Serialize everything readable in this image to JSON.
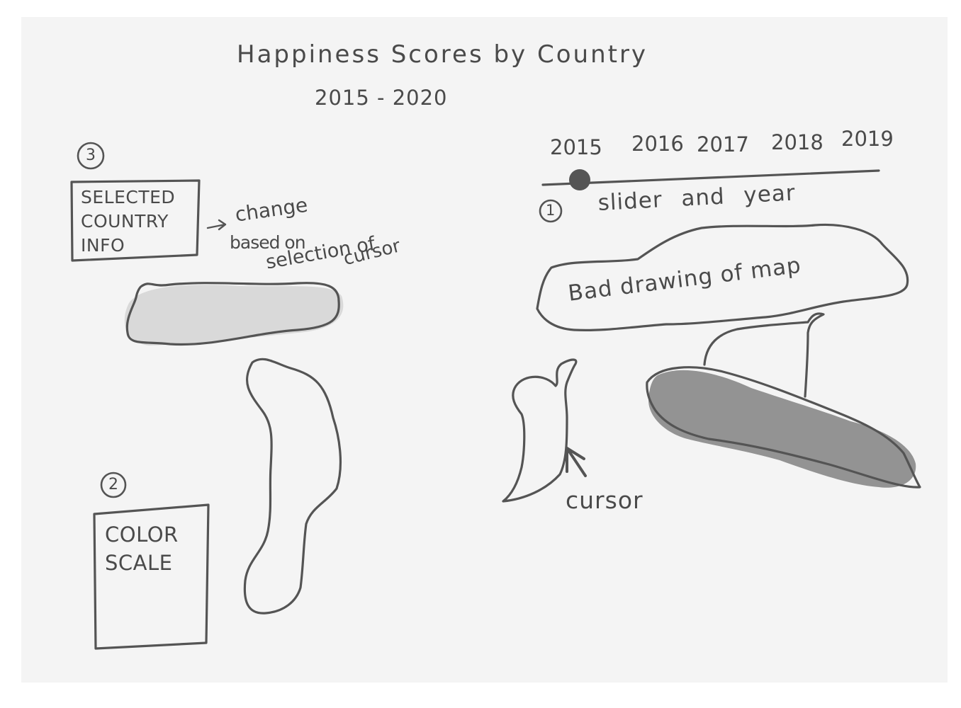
{
  "title": "Happiness Scores by Country",
  "subtitle": "2015 - 2020",
  "slider": {
    "years": [
      "2015",
      "2016",
      "2017",
      "2018",
      "2019"
    ],
    "selected": "2015",
    "number": "1",
    "caption": "slider and year"
  },
  "map": {
    "label": "Bad drawing of map"
  },
  "cursor": {
    "label": "cursor"
  },
  "info": {
    "number": "3",
    "box_label": "SELECTED\nCOUNTRY\nINFO",
    "note_line1": "change",
    "note_line2": "based on",
    "note_line3": "selection of",
    "note_line4": "cursor"
  },
  "legend": {
    "number": "2",
    "box_label": "COLOR\nSCALE"
  },
  "colors": {
    "ink": "#545454",
    "paper": "#f4f4f4",
    "light_fill": "#d9d9d9",
    "dark_fill": "#939393"
  }
}
